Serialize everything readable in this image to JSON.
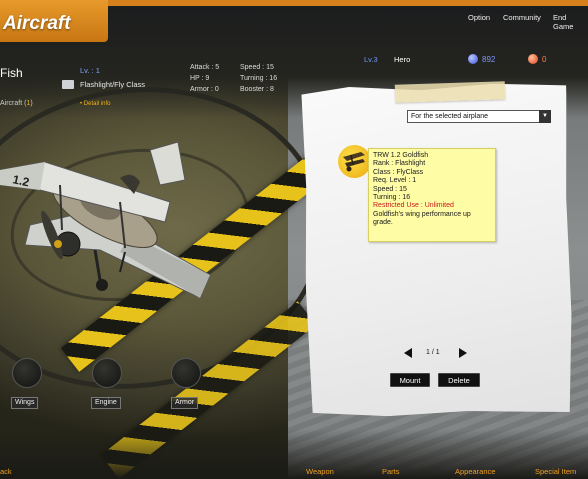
{
  "app": {
    "title": "Aircraft"
  },
  "top_menu": [
    {
      "label": "Option"
    },
    {
      "label": "Community"
    },
    {
      "label": "End Game"
    }
  ],
  "player": {
    "level": "Lv.3",
    "name": "Hero",
    "currency_blue": "892",
    "currency_red": "0"
  },
  "aircraft": {
    "name": "Fish",
    "level": "Lv. : 1",
    "class": "Flashlight/Fly Class",
    "count_label": "Aircraft (",
    "count_value": "1",
    "count_suffix": ")",
    "detail_link": "• Detail info",
    "stats": {
      "attack": "Attack : 5",
      "hp": "HP : 9",
      "armor": "Armor : 0",
      "speed": "Speed : 15",
      "turning": "Turning : 16",
      "booster": "Booster : 8"
    }
  },
  "parts_panel": {
    "filter_selected": "For the selected airplane",
    "filter_arrow": "▼",
    "item": {
      "name": "TRW 1.2 Goldfish",
      "rank": "Rank : Flashlight",
      "class": "Class : FlyClass",
      "req_level": "Req. Level : 1",
      "speed": "Speed : 15",
      "turning": "Turning : 16",
      "restriction": "Restricted Use : Unlimited",
      "description": "Goldfish's wing performance up grade."
    },
    "pager": "1 / 1",
    "mount_label": "Mount",
    "delete_label": "Delete"
  },
  "part_slots": [
    {
      "label": "Wings"
    },
    {
      "label": "Engine"
    },
    {
      "label": "Armor"
    }
  ],
  "bottom_nav": [
    {
      "label": "ack"
    },
    {
      "label": "Weapon"
    },
    {
      "label": "Parts"
    },
    {
      "label": "Appearance"
    },
    {
      "label": "Special Item"
    }
  ],
  "colors": {
    "accent_orange": "#e79a2a",
    "tooltip_bg": "#fffca6",
    "restriction_red": "#c81818",
    "hazard_yellow": "#e6c21a"
  },
  "plane_markings": "1.2"
}
